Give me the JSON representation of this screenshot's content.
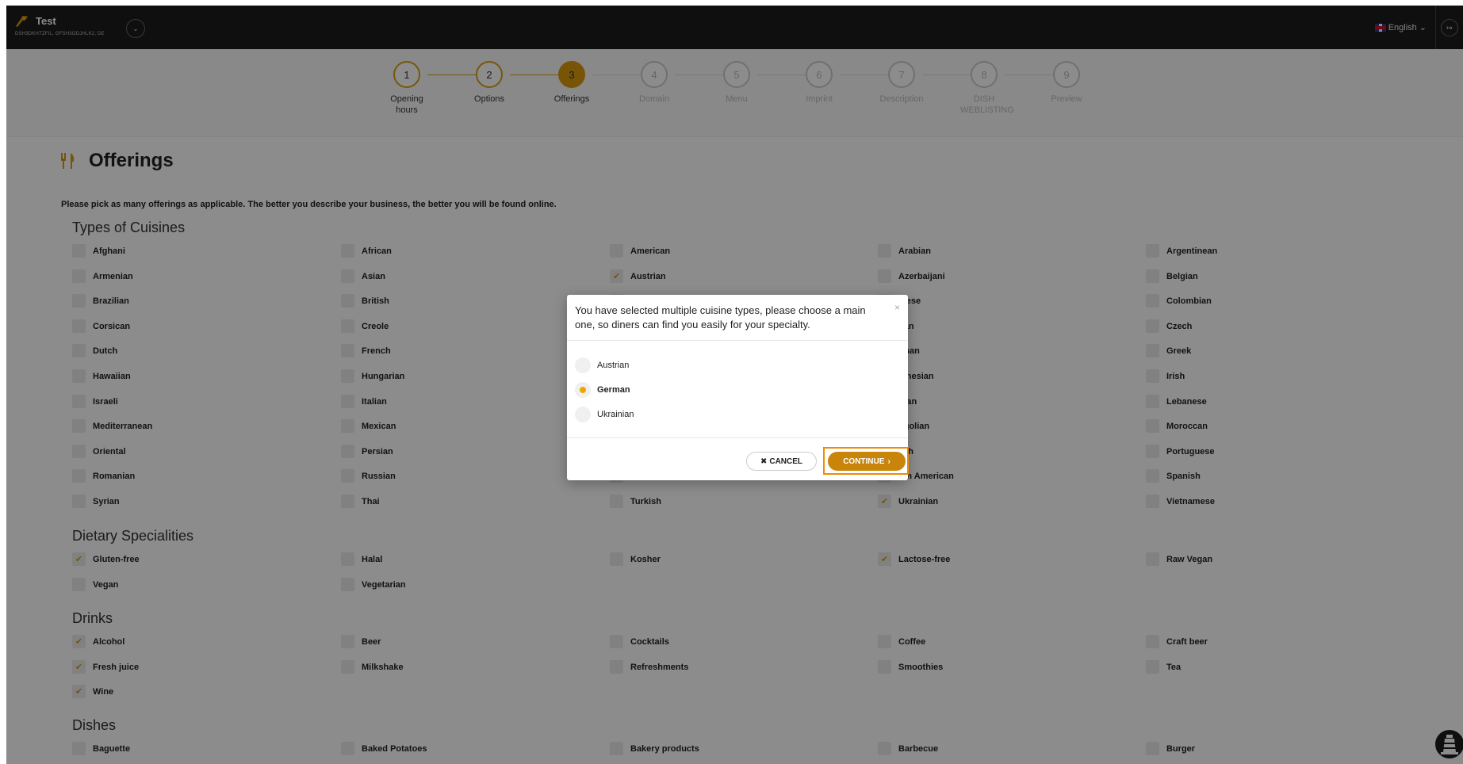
{
  "topbar": {
    "title": "Test",
    "subtitle": "DSH3DKHTZFIL, GFSH3ODJHLK2, DE",
    "language": "English"
  },
  "steps": [
    {
      "num": "1",
      "label": "Opening hours",
      "state": "done"
    },
    {
      "num": "2",
      "label": "Options",
      "state": "done"
    },
    {
      "num": "3",
      "label": "Offerings",
      "state": "active"
    },
    {
      "num": "4",
      "label": "Domain",
      "state": "future"
    },
    {
      "num": "5",
      "label": "Menu",
      "state": "future"
    },
    {
      "num": "6",
      "label": "Imprint",
      "state": "future"
    },
    {
      "num": "7",
      "label": "Description",
      "state": "future"
    },
    {
      "num": "8",
      "label": "DISH WEBLISTING",
      "state": "future"
    },
    {
      "num": "9",
      "label": "Preview",
      "state": "future"
    }
  ],
  "page": {
    "title": "Offerings",
    "intro": "Please pick as many offerings as applicable. The better you describe your business, the better you will be found online."
  },
  "groups": {
    "cuisines": {
      "title": "Types of Cuisines",
      "items": [
        {
          "label": "Afghani",
          "checked": false
        },
        {
          "label": "African",
          "checked": false
        },
        {
          "label": "American",
          "checked": false
        },
        {
          "label": "Arabian",
          "checked": false
        },
        {
          "label": "Argentinean",
          "checked": false
        },
        {
          "label": "Armenian",
          "checked": false
        },
        {
          "label": "Asian",
          "checked": false
        },
        {
          "label": "Austrian",
          "checked": true
        },
        {
          "label": "Azerbaijani",
          "checked": false
        },
        {
          "label": "Belgian",
          "checked": false
        },
        {
          "label": "Brazilian",
          "checked": false
        },
        {
          "label": "British",
          "checked": false
        },
        {
          "label": "",
          "checked": false
        },
        {
          "label": "inese",
          "checked": false
        },
        {
          "label": "Colombian",
          "checked": false
        },
        {
          "label": "Corsican",
          "checked": false
        },
        {
          "label": "Creole",
          "checked": false
        },
        {
          "label": "",
          "checked": false
        },
        {
          "label": "ban",
          "checked": false
        },
        {
          "label": "Czech",
          "checked": false
        },
        {
          "label": "Dutch",
          "checked": false
        },
        {
          "label": "French",
          "checked": false
        },
        {
          "label": "",
          "checked": false
        },
        {
          "label": "rman",
          "checked": false
        },
        {
          "label": "Greek",
          "checked": false
        },
        {
          "label": "Hawaiian",
          "checked": false
        },
        {
          "label": "Hungarian",
          "checked": false
        },
        {
          "label": "",
          "checked": false
        },
        {
          "label": "lonesian",
          "checked": false
        },
        {
          "label": "Irish",
          "checked": false
        },
        {
          "label": "Israeli",
          "checked": false
        },
        {
          "label": "Italian",
          "checked": false
        },
        {
          "label": "",
          "checked": false
        },
        {
          "label": "rean",
          "checked": false
        },
        {
          "label": "Lebanese",
          "checked": false
        },
        {
          "label": "Mediterranean",
          "checked": false
        },
        {
          "label": "Mexican",
          "checked": false
        },
        {
          "label": "",
          "checked": false
        },
        {
          "label": "ngolian",
          "checked": false
        },
        {
          "label": "Moroccan",
          "checked": false
        },
        {
          "label": "Oriental",
          "checked": false
        },
        {
          "label": "Persian",
          "checked": false
        },
        {
          "label": "",
          "checked": false
        },
        {
          "label": "lish",
          "checked": false
        },
        {
          "label": "Portuguese",
          "checked": false
        },
        {
          "label": "Romanian",
          "checked": false
        },
        {
          "label": "Russian",
          "checked": false
        },
        {
          "label": "",
          "checked": false
        },
        {
          "label": "uth American",
          "checked": false
        },
        {
          "label": "Spanish",
          "checked": false
        },
        {
          "label": "Syrian",
          "checked": false
        },
        {
          "label": "Thai",
          "checked": false
        },
        {
          "label": "Turkish",
          "checked": false
        },
        {
          "label": "Ukrainian",
          "checked": true
        },
        {
          "label": "Vietnamese",
          "checked": false
        }
      ]
    },
    "dietary": {
      "title": "Dietary Specialities",
      "items": [
        {
          "label": "Gluten-free",
          "checked": true
        },
        {
          "label": "Halal",
          "checked": false
        },
        {
          "label": "Kosher",
          "checked": false
        },
        {
          "label": "Lactose-free",
          "checked": true
        },
        {
          "label": "Raw Vegan",
          "checked": false
        },
        {
          "label": "Vegan",
          "checked": false
        },
        {
          "label": "Vegetarian",
          "checked": false
        }
      ]
    },
    "drinks": {
      "title": "Drinks",
      "items": [
        {
          "label": "Alcohol",
          "checked": true
        },
        {
          "label": "Beer",
          "checked": false
        },
        {
          "label": "Cocktails",
          "checked": false
        },
        {
          "label": "Coffee",
          "checked": false
        },
        {
          "label": "Craft beer",
          "checked": false
        },
        {
          "label": "Fresh juice",
          "checked": true
        },
        {
          "label": "Milkshake",
          "checked": false
        },
        {
          "label": "Refreshments",
          "checked": false
        },
        {
          "label": "Smoothies",
          "checked": false
        },
        {
          "label": "Tea",
          "checked": false
        },
        {
          "label": "Wine",
          "checked": true
        }
      ]
    },
    "dishes": {
      "title": "Dishes",
      "items": [
        {
          "label": "Baguette",
          "checked": false
        },
        {
          "label": "Baked Potatoes",
          "checked": false
        },
        {
          "label": "Bakery products",
          "checked": false
        },
        {
          "label": "Barbecue",
          "checked": false
        },
        {
          "label": "Burger",
          "checked": false
        }
      ]
    }
  },
  "modal": {
    "message": "You have selected multiple cuisine types, please choose a main one, so diners can find you easily for your specialty.",
    "options": [
      {
        "label": "Austrian",
        "selected": false
      },
      {
        "label": "German",
        "selected": true
      },
      {
        "label": "Ukrainian",
        "selected": false
      }
    ],
    "cancel_label": "CANCEL",
    "continue_label": "CONTINUE"
  },
  "colors": {
    "accent": "#d99a0b",
    "topbar": "#1d1d1d",
    "highlight": "#f08a00"
  }
}
